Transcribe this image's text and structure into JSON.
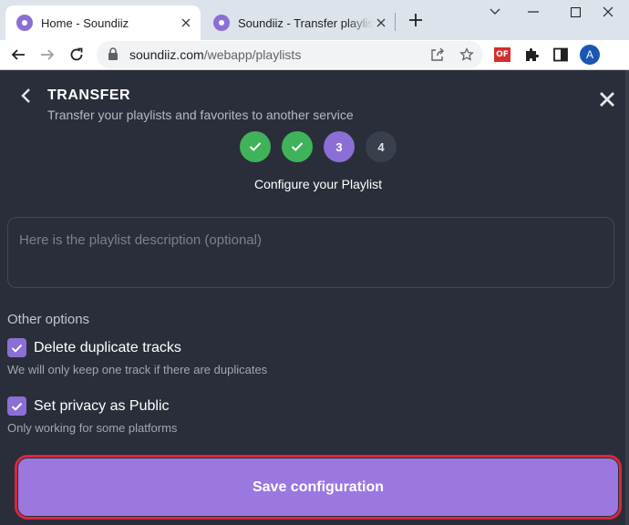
{
  "browser": {
    "tabs": [
      {
        "title": "Home - Soundiiz",
        "active": true,
        "icon": "soundiiz-favicon"
      },
      {
        "title": "Soundiiz - Transfer playlists and",
        "active": false,
        "icon": "soundiiz-favicon"
      }
    ],
    "url_host": "soundiiz.com",
    "url_path": "/webapp/playlists",
    "extension_label": "OF",
    "profile_initial": "A"
  },
  "transfer": {
    "title": "TRANSFER",
    "subtitle": "Transfer your playlists and favorites to another service",
    "steps": [
      {
        "label": "1",
        "state": "done",
        "icon": "check-icon"
      },
      {
        "label": "2",
        "state": "done",
        "icon": "check-icon"
      },
      {
        "label": "3",
        "state": "current"
      },
      {
        "label": "4",
        "state": "todo"
      }
    ],
    "step_title": "Configure your Playlist",
    "description": {
      "value": "",
      "placeholder": "Here is the playlist description (optional)"
    },
    "options_heading": "Other options",
    "options": [
      {
        "label": "Delete duplicate tracks",
        "help": "We will only keep one track if there are duplicates",
        "checked": true
      },
      {
        "label": "Set privacy as Public",
        "help": "Only working for some platforms",
        "checked": true
      }
    ],
    "save_label": "Save configuration"
  },
  "colors": {
    "accent": "#8b6fd6",
    "success": "#3fb35a",
    "background": "#2a2e3a",
    "highlight_border": "#d8283a"
  }
}
